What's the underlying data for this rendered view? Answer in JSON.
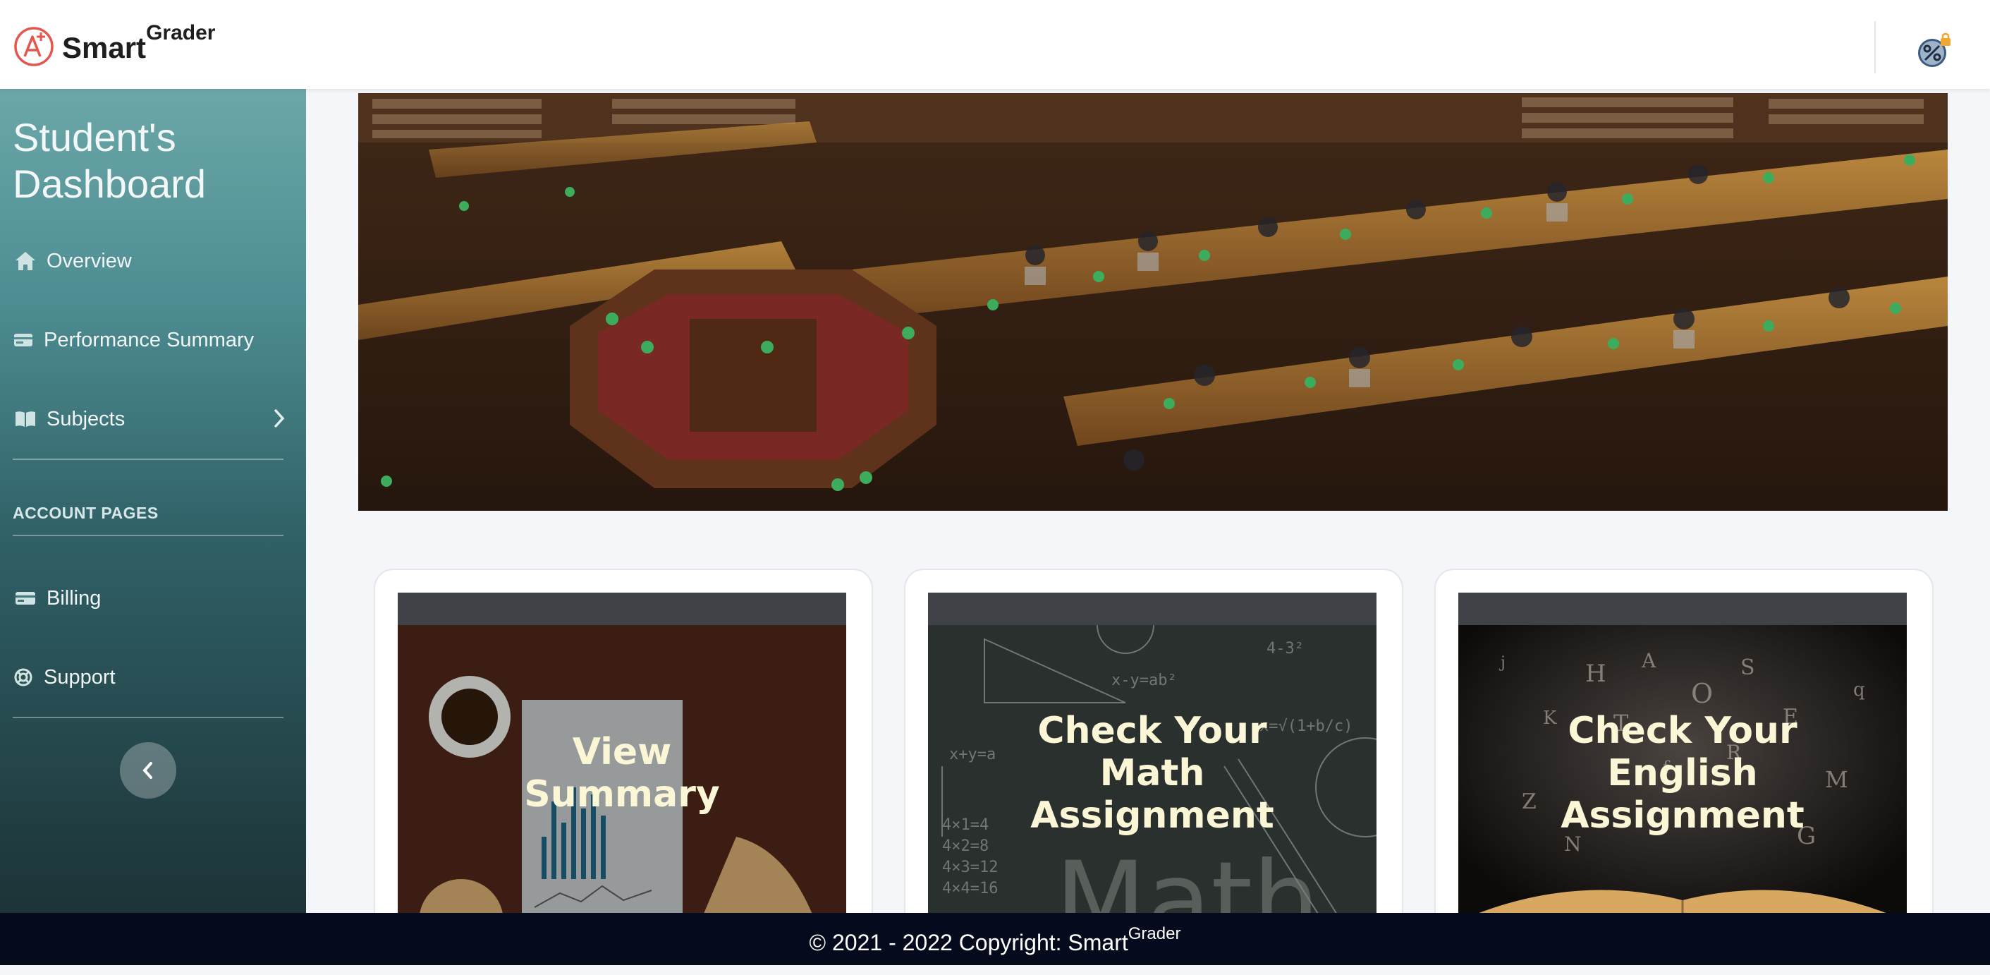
{
  "header": {
    "brand_main": "Smart",
    "brand_sup": "Grader",
    "logo_icon": "a-plus-logo-icon",
    "user_icon": "user-avatar-icon"
  },
  "sidebar": {
    "title": "Student's Dashboard",
    "items": [
      {
        "label": "Overview",
        "icon": "home-icon"
      },
      {
        "label": "Performance Summary",
        "icon": "card-icon"
      },
      {
        "label": "Subjects",
        "icon": "book-icon",
        "has_submenu": true
      }
    ],
    "section_label": "ACCOUNT PAGES",
    "account_items": [
      {
        "label": "Billing",
        "icon": "credit-card-icon"
      },
      {
        "label": "Support",
        "icon": "lifebuoy-icon"
      }
    ]
  },
  "cards": [
    {
      "label": "View Summary",
      "theme": "#4a2419"
    },
    {
      "label": "Check Your Math Assignment",
      "theme": "#2a302d"
    },
    {
      "label": "Check Your English Assignment",
      "theme": "#1a1714"
    }
  ],
  "footer": {
    "text": "© 2021 - 2022 Copyright: Smart",
    "sup": "Grader"
  },
  "colors": {
    "accent": "#e4574f",
    "sidebar_top": "#6ba7a8",
    "sidebar_bottom": "#1c3337",
    "footer_bg": "#050b1c"
  }
}
